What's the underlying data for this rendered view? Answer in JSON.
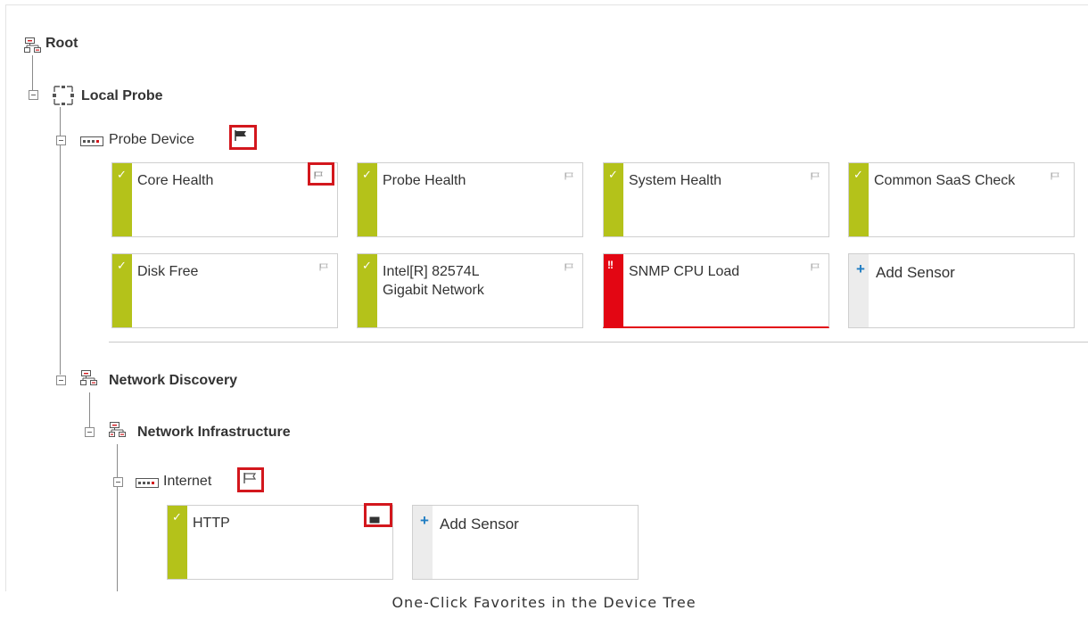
{
  "tree": {
    "root": {
      "label": "Root"
    },
    "local_probe": {
      "label": "Local Probe"
    },
    "probe_device": {
      "label": "Probe Device"
    },
    "network_discovery": {
      "label": "Network Discovery"
    },
    "network_infrastructure": {
      "label": "Network Infrastructure"
    },
    "internet": {
      "label": "Internet"
    }
  },
  "sensors": {
    "core_health": {
      "name": "Core Health",
      "status": "up",
      "mark": "✓"
    },
    "probe_health": {
      "name": "Probe Health",
      "status": "up",
      "mark": "✓"
    },
    "system_health": {
      "name": "System Health",
      "status": "up",
      "mark": "✓"
    },
    "common_saas_check": {
      "name": "Common SaaS Check",
      "status": "up",
      "mark": "✓"
    },
    "disk_free": {
      "name": "Disk Free",
      "status": "up",
      "mark": "✓"
    },
    "intel_network": {
      "name": "Intel[R] 82574L Gigabit Network",
      "status": "up",
      "mark": "✓"
    },
    "snmp_cpu_load": {
      "name": "SNMP CPU Load",
      "status": "down",
      "mark": "!!"
    },
    "http": {
      "name": "HTTP",
      "status": "up",
      "mark": "✓"
    }
  },
  "add_sensor": {
    "label": "Add Sensor",
    "icon": "+"
  },
  "caption": "One-Click Favorites in the Device Tree",
  "colors": {
    "status_up": "#b4c21a",
    "status_down": "#e30613",
    "highlight": "#d3171d",
    "add_plus": "#1f7dc3"
  }
}
